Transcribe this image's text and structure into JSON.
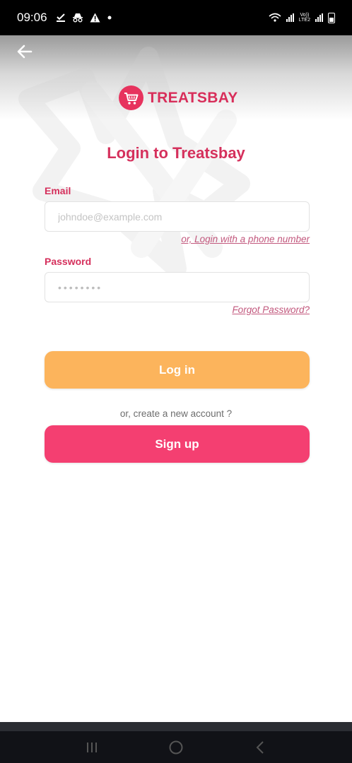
{
  "status_bar": {
    "time": "09:06",
    "left_icons": [
      "check-download-icon",
      "incognito-icon",
      "warning-icon",
      "dot-icon"
    ],
    "network_label_top": "Vo))",
    "network_label_bottom": "LTE2"
  },
  "header": {
    "back_icon": "arrow-left-icon",
    "brand_name": "TREATSBAY",
    "logo_icon": "shopping-cart-icon"
  },
  "login": {
    "title": "Login to Treatsbay",
    "email_label": "Email",
    "email_placeholder": "johndoe@example.com",
    "email_value": "",
    "phone_link": "or, Login with a phone number",
    "password_label": "Password",
    "password_masked": "••••••••",
    "forgot_link": "Forgot Password?",
    "login_button": "Log in",
    "create_text": "or, create a new account ?",
    "signup_button": "Sign up"
  },
  "colors": {
    "brand": "#d5305c",
    "login_button": "#fcb45c",
    "signup_button": "#f43f71"
  },
  "nav_bar": {
    "icons": [
      "recent-apps-icon",
      "home-icon",
      "back-nav-icon"
    ]
  }
}
